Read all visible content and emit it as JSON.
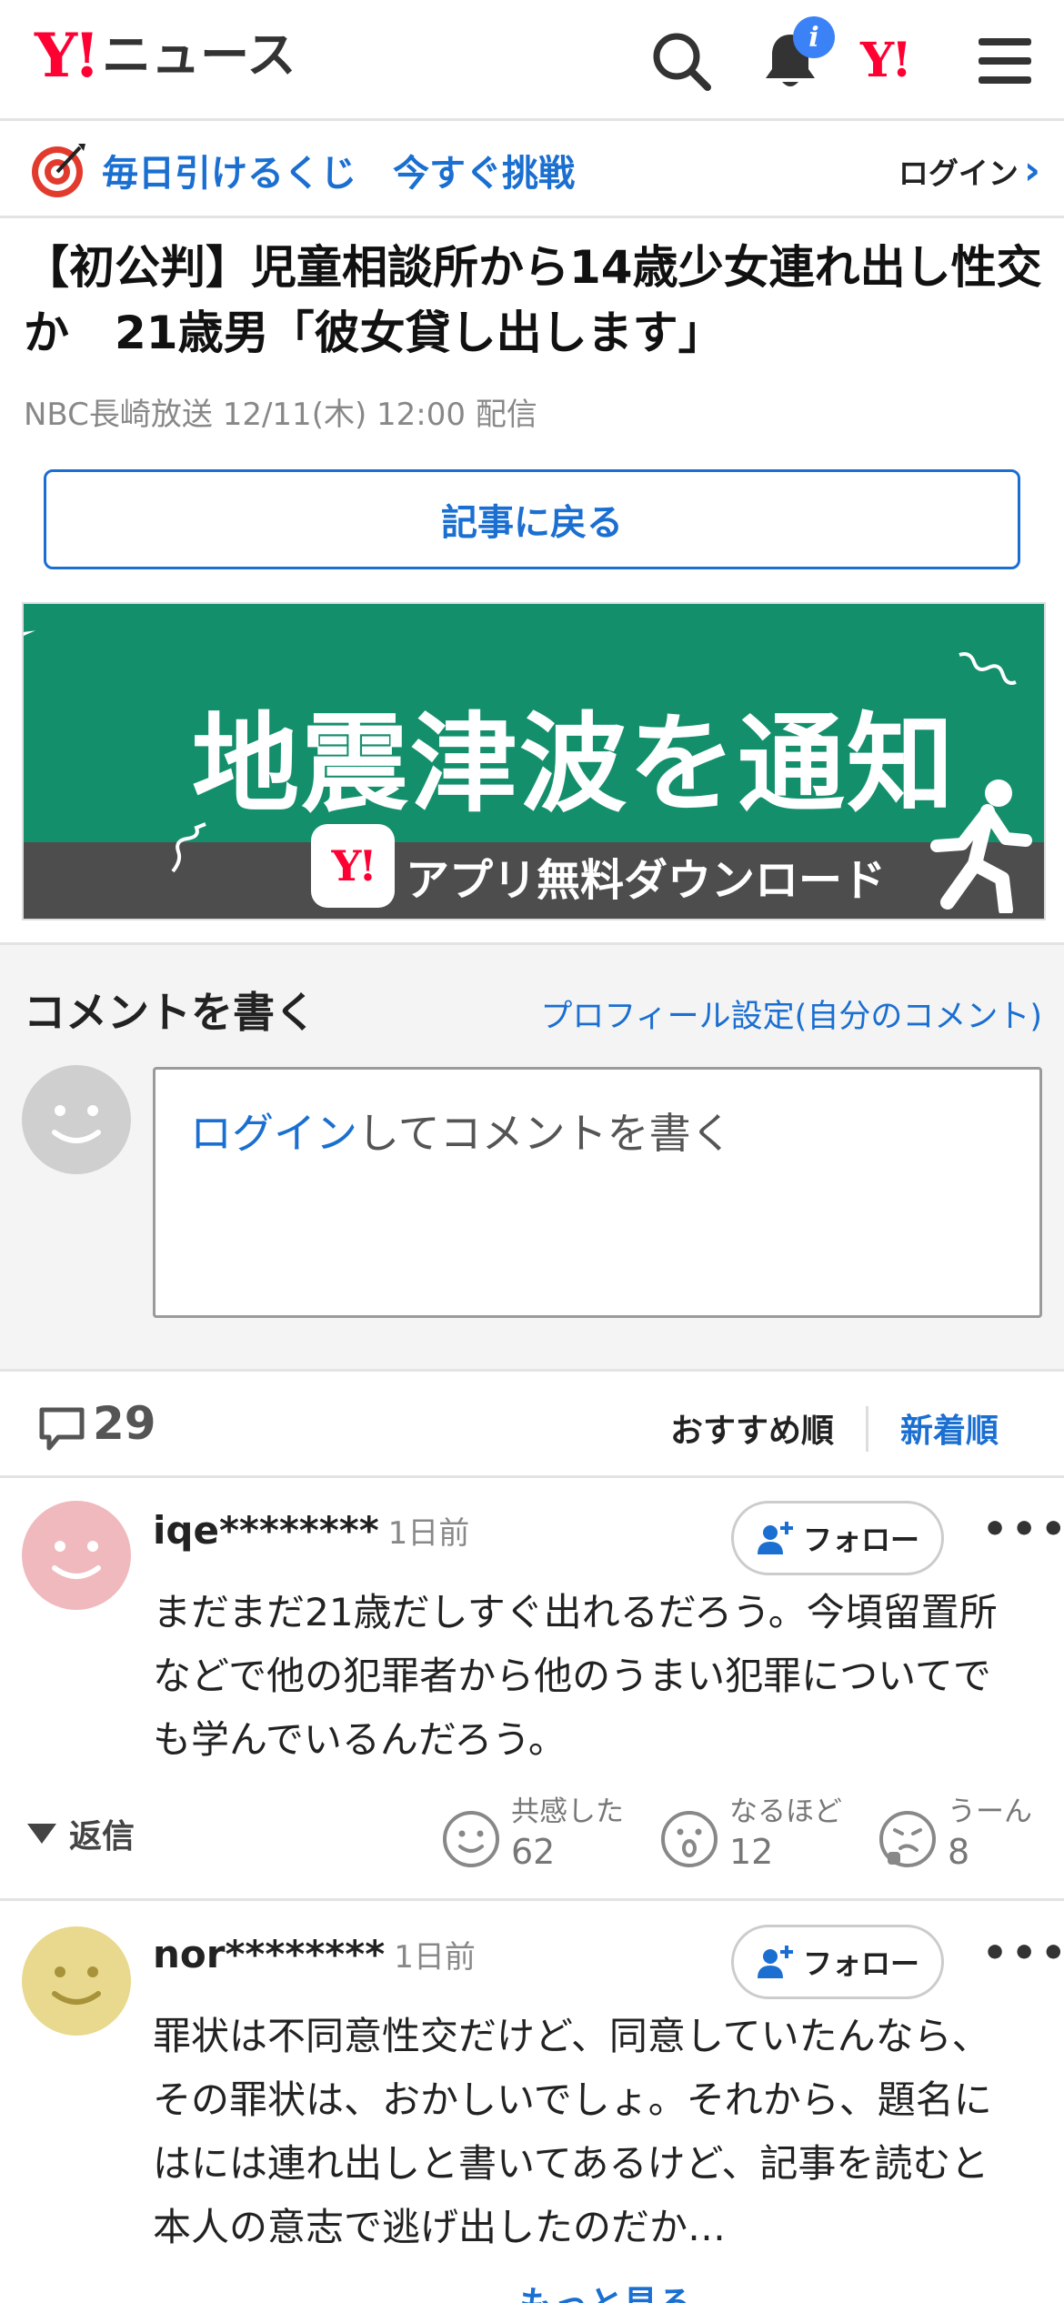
{
  "header": {
    "logo_mark": "Y!",
    "logo_text": "ニュース",
    "notification_badge": "i",
    "yahoo_mark": "Y!"
  },
  "promo": {
    "text": "毎日引けるくじ　今すぐ挑戦",
    "login": "ログイン",
    "chevron": "›"
  },
  "article": {
    "title": "【初公判】児童相談所から14歳少女連れ出し性交か　21歳男「彼女貸し出します」",
    "meta": "NBC長崎放送 12/11(木) 12:00 配信",
    "back_button": "記事に戻る"
  },
  "banner": {
    "headline": "地震津波を通知",
    "app_mark": "Y!",
    "subtitle": "アプリ無料ダウンロード",
    "colors": {
      "green": "#148f6c",
      "gray": "#4d4d4d"
    }
  },
  "comment_form": {
    "title": "コメントを書く",
    "profile_link": "プロフィール設定(自分のコメント)",
    "login_link": "ログイン",
    "prompt_rest": "してコメントを書く"
  },
  "comments_bar": {
    "count": "29",
    "sort_recommended": "おすすめ順",
    "sort_newest": "新着順"
  },
  "comments": [
    {
      "user": "iqe********",
      "time": "1日前",
      "follow": "フォロー",
      "more": "•••",
      "text": "まだまだ21歳だしすぐ出れるだろう。今頃留置所などで他の犯罪者から他のうまい犯罪についてでも学んでいるんだろう。",
      "reply": "返信",
      "reactions": [
        {
          "label": "共感した",
          "count": "62",
          "icon": "smile-face-icon"
        },
        {
          "label": "なるほど",
          "count": "12",
          "icon": "surprised-face-icon"
        },
        {
          "label": "うーん",
          "count": "8",
          "icon": "thinking-face-icon"
        }
      ],
      "avatar_color": "#f0b9bd"
    },
    {
      "user": "nor********",
      "time": "1日前",
      "follow": "フォロー",
      "more": "•••",
      "text": "罪状は不同意性交だけど、同意していたんなら、その罪状は、おかしいでしょ。それから、題名にはには連れ出しと書いてあるけど、記事を読むと本人の意志で逃げ出したのだか…",
      "more_link": "— もっと見る",
      "avatar_color": "#e8d98e"
    }
  ],
  "accent_color": "#1a6fd1",
  "brand_red": "#ff0033"
}
